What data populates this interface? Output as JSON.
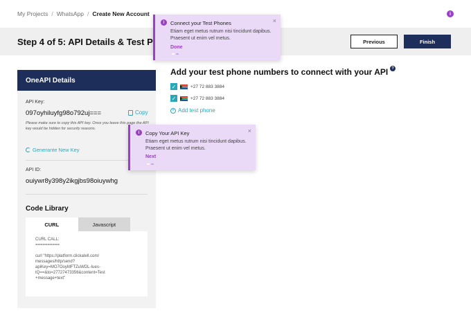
{
  "breadcrumb": {
    "items": [
      "My Projects",
      "WhatsApp",
      "Create New Account"
    ],
    "separator": "/"
  },
  "header": {
    "title": "Step 4 of 5: API Details & Test Phones",
    "previous_label": "Previous",
    "finish_label": "Finish"
  },
  "left_card": {
    "heading": "OneAPI Details",
    "api_key_label": "API Key:",
    "api_key_value": "097oyhiluyfg98o792uj===",
    "copy_label": "Copy",
    "api_key_note": "Please make sure to copy this API key. Once you leave this page the API key would be hidden for security reasons.",
    "regenerate_label": "Generante New Key",
    "api_id_label": "API ID:",
    "api_id_value": "ouiywr8y398y2ikgjbs98oiuywhg",
    "code_library_title": "Code Library",
    "tabs": [
      {
        "label": "CURL",
        "active": true
      },
      {
        "label": "Javascript",
        "active": false
      }
    ],
    "code_lines": [
      "CURL CALL:",
      "==========",
      "",
      "curl \"https://platform.clickatell.com/",
      "messages/http/send?",
      "apiKey=MO7OoyMFTZuWDL-Iues-",
      "tQ==&to=27727473356&content=Test",
      "+message+text\""
    ]
  },
  "right": {
    "title": "Add your test phone numbers to connect with your API",
    "help_icon_label": "?",
    "phones": [
      {
        "number": "+27 72 883 3884",
        "checked": true
      },
      {
        "number": "+27 72 883 3884",
        "checked": true
      }
    ],
    "add_phone_label": "Add test phone"
  },
  "tooltips": {
    "connect": {
      "title": "Connect your Test Phones",
      "body": "Etiam eget metus rutrum nisi tincidunt dapibus. Praesent ut enim vel metus.",
      "action": "Done"
    },
    "copy": {
      "title": "Copy Your API Key",
      "body": "Etiam eget metus rutrum nisi tincidunt dapibus. Praesent ut enim vel metus.",
      "action": "Next"
    },
    "info_glyph": "i",
    "close_glyph": "×"
  },
  "icons": {
    "checkbox": "checkmark-icon",
    "flag": "south-africa-flag-icon",
    "copy": "copy-icon",
    "regenerate": "refresh-icon",
    "add": "plus-circle-icon"
  },
  "colors": {
    "navy": "#1d2e5a",
    "teal": "#2aa8b8",
    "purple": "#9b3ec8",
    "tooltip_bg": "#ead9f7"
  }
}
